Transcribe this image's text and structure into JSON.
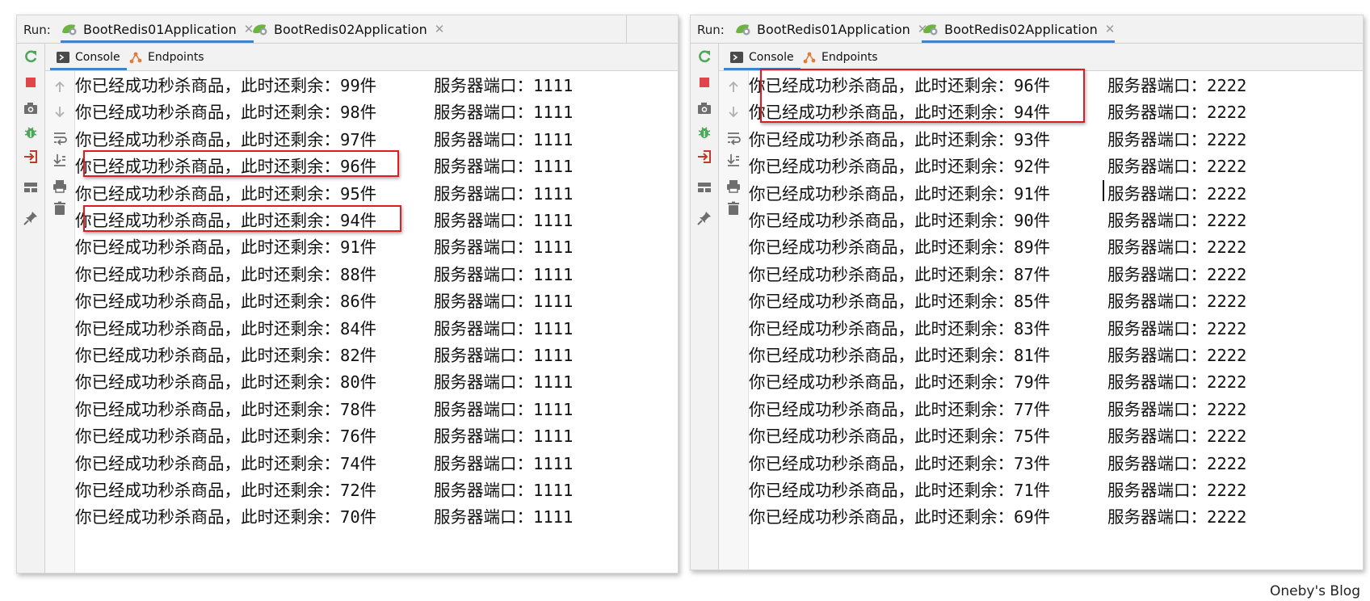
{
  "left": {
    "run_label": "Run:",
    "tabs": [
      {
        "label": "BootRedis01Application",
        "active": true
      },
      {
        "label": "BootRedis02Application",
        "active": false
      }
    ],
    "subtabs": [
      {
        "label": "Console",
        "active": true
      },
      {
        "label": "Endpoints",
        "active": false
      }
    ],
    "lines": [
      {
        "msg": "你已经成功秒杀商品，此时还剩余：99件",
        "port": "服务器端口：1111"
      },
      {
        "msg": "你已经成功秒杀商品，此时还剩余：98件",
        "port": "服务器端口：1111"
      },
      {
        "msg": "你已经成功秒杀商品，此时还剩余：97件",
        "port": "服务器端口：1111"
      },
      {
        "msg": "你已经成功秒杀商品，此时还剩余：96件",
        "port": "服务器端口：1111"
      },
      {
        "msg": "你已经成功秒杀商品，此时还剩余：95件",
        "port": "服务器端口：1111"
      },
      {
        "msg": "你已经成功秒杀商品，此时还剩余：94件",
        "port": "服务器端口：1111"
      },
      {
        "msg": "你已经成功秒杀商品，此时还剩余：91件",
        "port": "服务器端口：1111"
      },
      {
        "msg": "你已经成功秒杀商品，此时还剩余：88件",
        "port": "服务器端口：1111"
      },
      {
        "msg": "你已经成功秒杀商品，此时还剩余：86件",
        "port": "服务器端口：1111"
      },
      {
        "msg": "你已经成功秒杀商品，此时还剩余：84件",
        "port": "服务器端口：1111"
      },
      {
        "msg": "你已经成功秒杀商品，此时还剩余：82件",
        "port": "服务器端口：1111"
      },
      {
        "msg": "你已经成功秒杀商品，此时还剩余：80件",
        "port": "服务器端口：1111"
      },
      {
        "msg": "你已经成功秒杀商品，此时还剩余：78件",
        "port": "服务器端口：1111"
      },
      {
        "msg": "你已经成功秒杀商品，此时还剩余：76件",
        "port": "服务器端口：1111"
      },
      {
        "msg": "你已经成功秒杀商品，此时还剩余：74件",
        "port": "服务器端口：1111"
      },
      {
        "msg": "你已经成功秒杀商品，此时还剩余：72件",
        "port": "服务器端口：1111"
      },
      {
        "msg": "你已经成功秒杀商品，此时还剩余：70件",
        "port": "服务器端口：1111"
      }
    ]
  },
  "right": {
    "run_label": "Run:",
    "tabs": [
      {
        "label": "BootRedis01Application",
        "active": false
      },
      {
        "label": "BootRedis02Application",
        "active": true
      }
    ],
    "subtabs": [
      {
        "label": "Console",
        "active": true
      },
      {
        "label": "Endpoints",
        "active": false
      }
    ],
    "lines": [
      {
        "msg": "你已经成功秒杀商品，此时还剩余：96件",
        "port": "服务器端口：2222"
      },
      {
        "msg": "你已经成功秒杀商品，此时还剩余：94件",
        "port": "服务器端口：2222"
      },
      {
        "msg": "你已经成功秒杀商品，此时还剩余：93件",
        "port": "服务器端口：2222"
      },
      {
        "msg": "你已经成功秒杀商品，此时还剩余：92件",
        "port": "服务器端口：2222"
      },
      {
        "msg": "你已经成功秒杀商品，此时还剩余：91件",
        "port": "服务器端口：2222"
      },
      {
        "msg": "你已经成功秒杀商品，此时还剩余：90件",
        "port": "服务器端口：2222"
      },
      {
        "msg": "你已经成功秒杀商品，此时还剩余：89件",
        "port": "服务器端口：2222"
      },
      {
        "msg": "你已经成功秒杀商品，此时还剩余：87件",
        "port": "服务器端口：2222"
      },
      {
        "msg": "你已经成功秒杀商品，此时还剩余：85件",
        "port": "服务器端口：2222"
      },
      {
        "msg": "你已经成功秒杀商品，此时还剩余：83件",
        "port": "服务器端口：2222"
      },
      {
        "msg": "你已经成功秒杀商品，此时还剩余：81件",
        "port": "服务器端口：2222"
      },
      {
        "msg": "你已经成功秒杀商品，此时还剩余：79件",
        "port": "服务器端口：2222"
      },
      {
        "msg": "你已经成功秒杀商品，此时还剩余：77件",
        "port": "服务器端口：2222"
      },
      {
        "msg": "你已经成功秒杀商品，此时还剩余：75件",
        "port": "服务器端口：2222"
      },
      {
        "msg": "你已经成功秒杀商品，此时还剩余：73件",
        "port": "服务器端口：2222"
      },
      {
        "msg": "你已经成功秒杀商品，此时还剩余：71件",
        "port": "服务器端口：2222"
      },
      {
        "msg": "你已经成功秒杀商品，此时还剩余：69件",
        "port": "服务器端口：2222"
      }
    ]
  },
  "watermark": "Oneby's Blog",
  "colors": {
    "highlight": "#e01b24",
    "tab_underline": "#4083c9",
    "spring_green": "#6db33f",
    "stop_red": "#e0454a",
    "rerun_green": "#4ea75a"
  },
  "icons": [
    "spring-boot-icon",
    "tab-close-icon",
    "console-icon",
    "endpoints-icon",
    "rerun-icon",
    "stop-icon",
    "camera-icon",
    "debug-bug-icon",
    "exit-icon",
    "layout-icon",
    "pin-icon",
    "up-arrow-icon",
    "down-arrow-icon",
    "soft-wrap-icon",
    "scroll-to-end-icon",
    "print-icon",
    "trash-icon"
  ]
}
